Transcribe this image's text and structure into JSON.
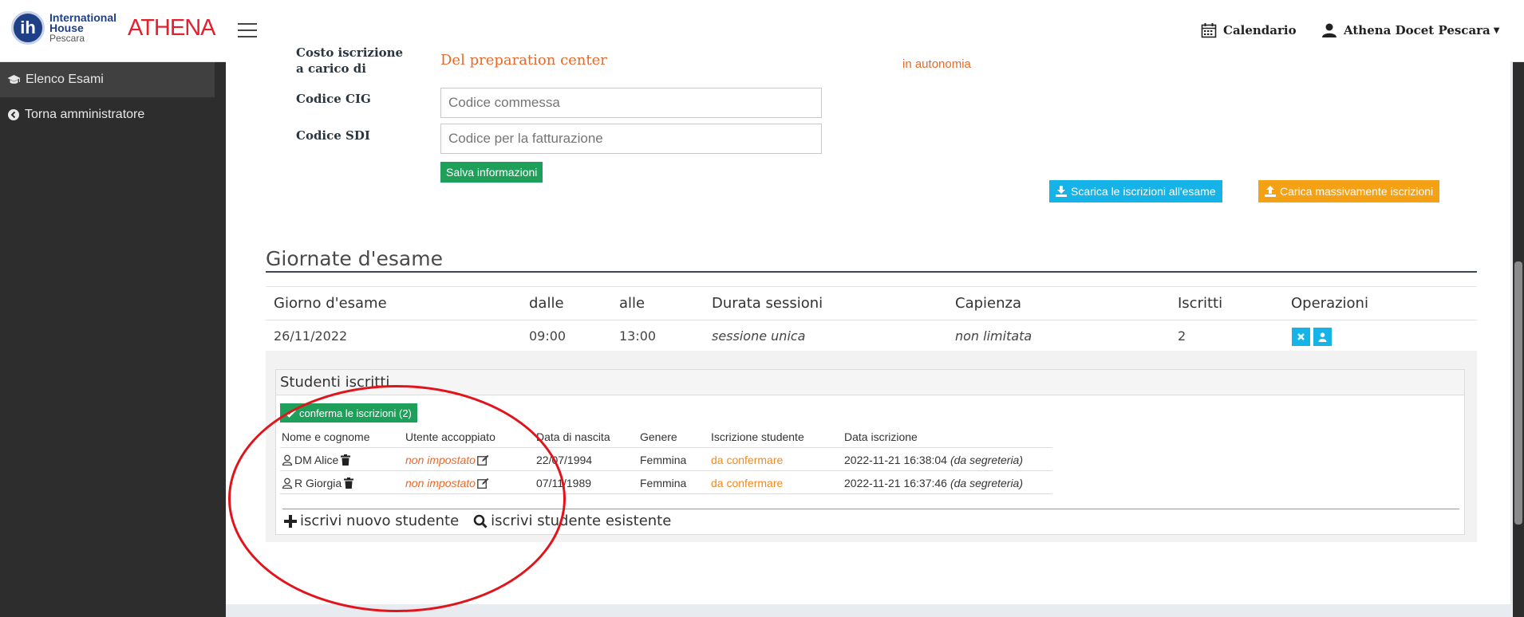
{
  "brand": {
    "ih_line1": "International",
    "ih_line2": "House",
    "ih_line3": "Pescara",
    "logo_letter": "ih",
    "product": "ATHENA"
  },
  "navbar": {
    "calendar_label": "Calendario",
    "user_label": "Athena Docet Pescara"
  },
  "sidebar": {
    "items": [
      {
        "label": "Elenco Esami",
        "icon": "graduation-cap-icon"
      },
      {
        "label": "Torna amministratore",
        "icon": "chevron-left-circle-icon"
      }
    ]
  },
  "form": {
    "cost_label_line1": "Costo iscrizione",
    "cost_label_line2": "a carico di",
    "cost_value": "Del preparation center",
    "autonomia_text": "in autonomia",
    "cig_label": "Codice CIG",
    "cig_placeholder": "Codice commessa",
    "sdi_label": "Codice SDI",
    "sdi_placeholder": "Codice per la fatturazione",
    "save_label": "Salva informazioni",
    "download_label": "Scarica le iscrizioni all'esame",
    "upload_label": "Carica massivamente iscrizioni"
  },
  "exam_days": {
    "title": "Giornate d'esame",
    "headers": [
      "Giorno d'esame",
      "dalle",
      "alle",
      "Durata sessioni",
      "Capienza",
      "Iscritti",
      "Operazioni"
    ],
    "row": [
      "26/11/2022",
      "09:00",
      "13:00",
      "sessione unica",
      "non limitata",
      "2"
    ]
  },
  "students": {
    "title": "Studenti iscritti",
    "confirm_label": "conferma le iscrizioni (2)",
    "headers": [
      "Nome e cognome",
      "Utente accoppiato",
      "Data di nascita",
      "Genere",
      "Iscrizione studente",
      "Data iscrizione"
    ],
    "rows": [
      {
        "name": "DM Alice",
        "user": "non impostato",
        "dob": "22/07/1994",
        "gender": "Femmina",
        "status": "da confermare",
        "date": "2022-11-21 16:38:04",
        "source": "(da segreteria)"
      },
      {
        "name": "R Giorgia",
        "user": "non impostato",
        "dob": "07/11/1989",
        "gender": "Femmina",
        "status": "da confermare",
        "date": "2022-11-21 16:37:46",
        "source": "(da segreteria)"
      }
    ],
    "add_new_label": "iscrivi nuovo studente",
    "add_existing_label": "iscrivi studente esistente"
  },
  "colors": {
    "accent_green": "#1ea05a",
    "accent_cyan": "#15b3e8",
    "accent_orange": "#f5a115",
    "text_orange": "#e8692a",
    "annotation_red": "#e2141b",
    "sidebar_bg": "#2d2d2d"
  }
}
